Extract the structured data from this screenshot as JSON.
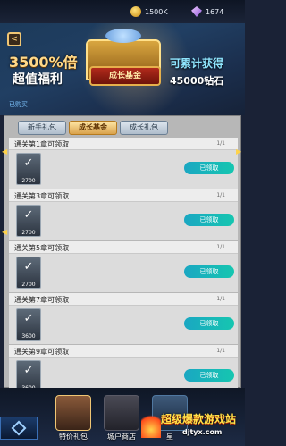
{
  "resources": {
    "gold": "1500K",
    "gems": "1674"
  },
  "banner": {
    "back_label": "<",
    "headline_multiplier": "3500%倍",
    "headline_sub": "超值福利",
    "status": "已购买",
    "fund_label": "成长基金",
    "reward_line1": "可累计获得",
    "reward_line2": "45000钻石"
  },
  "tabs": [
    {
      "label": "新手礼包",
      "active": false
    },
    {
      "label": "成长基金",
      "active": true
    },
    {
      "label": "成长礼包",
      "active": false
    }
  ],
  "rows": [
    {
      "title": "通关第1章可领取",
      "progress": "1/1",
      "amount": "2700",
      "status": "已领取"
    },
    {
      "title": "通关第3章可领取",
      "progress": "1/1",
      "amount": "2700",
      "status": "已领取"
    },
    {
      "title": "通关第5章可领取",
      "progress": "1/1",
      "amount": "2700",
      "status": "已领取"
    },
    {
      "title": "通关第7章可领取",
      "progress": "1/1",
      "amount": "3600",
      "status": "已领取"
    },
    {
      "title": "通关第9章可领取",
      "progress": "1/1",
      "amount": "3600",
      "status": "已领取"
    }
  ],
  "bottom_nav": [
    {
      "label": "特价礼包"
    },
    {
      "label": "城户商店"
    },
    {
      "label": "星"
    }
  ],
  "watermark": {
    "line1": "超级爆款游戏站",
    "line2": "djtyx.com"
  }
}
